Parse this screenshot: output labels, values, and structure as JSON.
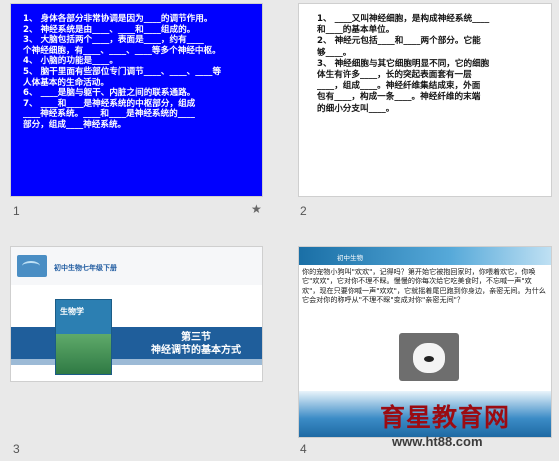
{
  "slides": [
    {
      "number": "1",
      "lines": [
        "1、 身体各部分非常协调是因为____的调节作用。",
        "2、 神经系统是由____、____和____组成的。",
        "3、 大脑包括两个____，表面是____，约有____",
        "个神经细胞，有____、____、____等多个神经中枢。",
        "4、 小脑的功能是____。",
        "5、 脑干里面有些部位专门调节____、____、____等",
        "人体基本的生命活动。",
        "6、 ____是脑与躯干、内脏之间的联系通路。",
        "7、 ____和____是神经系统的中枢部分，组成",
        "____神经系统。____和____是神经系统的____",
        "部分，组成____神经系统。"
      ]
    },
    {
      "number": "2",
      "lines": [
        "1、 ____又叫神经细胞，是构成神经系统____",
        "和____的基本单位。",
        "2、 神经元包括____和____两个部分。它能",
        "够____。",
        "3、 神经细胞与其它细胞明显不同，它的细胞",
        "体生有许多____，长的突起表面套有一层",
        "____，组成____。神经纤维集结成束，外面",
        "包有____，构成一条____。神经纤维的末端",
        "的细小分支叫____。"
      ]
    },
    {
      "number": "3",
      "grade_label": "初中生物七年级下册",
      "book_title": "生物学",
      "title_line1": "第三节",
      "title_line2": "神经调节的基本方式"
    },
    {
      "number": "4",
      "header_text": "初中生物",
      "body": "你的宠物小狗叫\"欢欢\"，记得吗？第开始它被抱回家时，你喂着欢它，你唤它\"欢欢\"，它对你不理不睬。慢慢的你每次给它吃美食时，不忘喊一声\"欢欢\"，现在只要你喊一声\"欢欢\"，它就摇着尾巴跑到你身边，亲密无间。为什么它会对你的称呼从\"不理不睬\"变成对你\"亲密无间\"？"
    }
  ],
  "watermark": {
    "text": "育星教育网",
    "url": "www.ht88.com"
  },
  "colors": {
    "slide1_bg": "#0000ff",
    "band_blue": "#1f5e9b",
    "watermark_red": "#9b0b12"
  },
  "icons": {
    "slide1_star": "star-icon"
  }
}
